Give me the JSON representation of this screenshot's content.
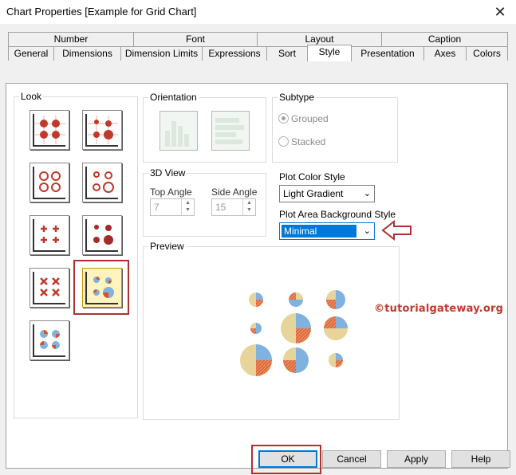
{
  "window": {
    "title": "Chart Properties [Example for Grid Chart]",
    "close_glyph": "✕"
  },
  "tabs": {
    "row1": [
      "Number",
      "Font",
      "Layout",
      "Caption"
    ],
    "row2": [
      "General",
      "Dimensions",
      "Dimension Limits",
      "Expressions",
      "Sort",
      "Style",
      "Presentation",
      "Axes",
      "Colors"
    ],
    "active": "Style"
  },
  "look": {
    "label": "Look",
    "selected_index": 7
  },
  "orientation": {
    "label": "Orientation"
  },
  "subtype": {
    "label": "Subtype",
    "options": [
      "Grouped",
      "Stacked"
    ],
    "selected": "Grouped"
  },
  "view3d": {
    "label": "3D View",
    "top_angle_label": "Top Angle",
    "top_angle_value": "7",
    "side_angle_label": "Side Angle",
    "side_angle_value": "15"
  },
  "plot_color_style": {
    "label": "Plot Color Style",
    "value": "Light Gradient"
  },
  "plot_area_bg_style": {
    "label": "Plot Area Background Style",
    "value": "Minimal"
  },
  "preview": {
    "label": "Preview"
  },
  "watermark": "©tutorialgateway.org",
  "buttons": {
    "ok": "OK",
    "cancel": "Cancel",
    "apply": "Apply",
    "help": "Help"
  },
  "colors": {
    "highlight": "#b03030",
    "pie_blue": "#7fb2de",
    "pie_tan": "#e6d49a",
    "pie_red": "#d9532a",
    "accent": "#0078d7"
  }
}
